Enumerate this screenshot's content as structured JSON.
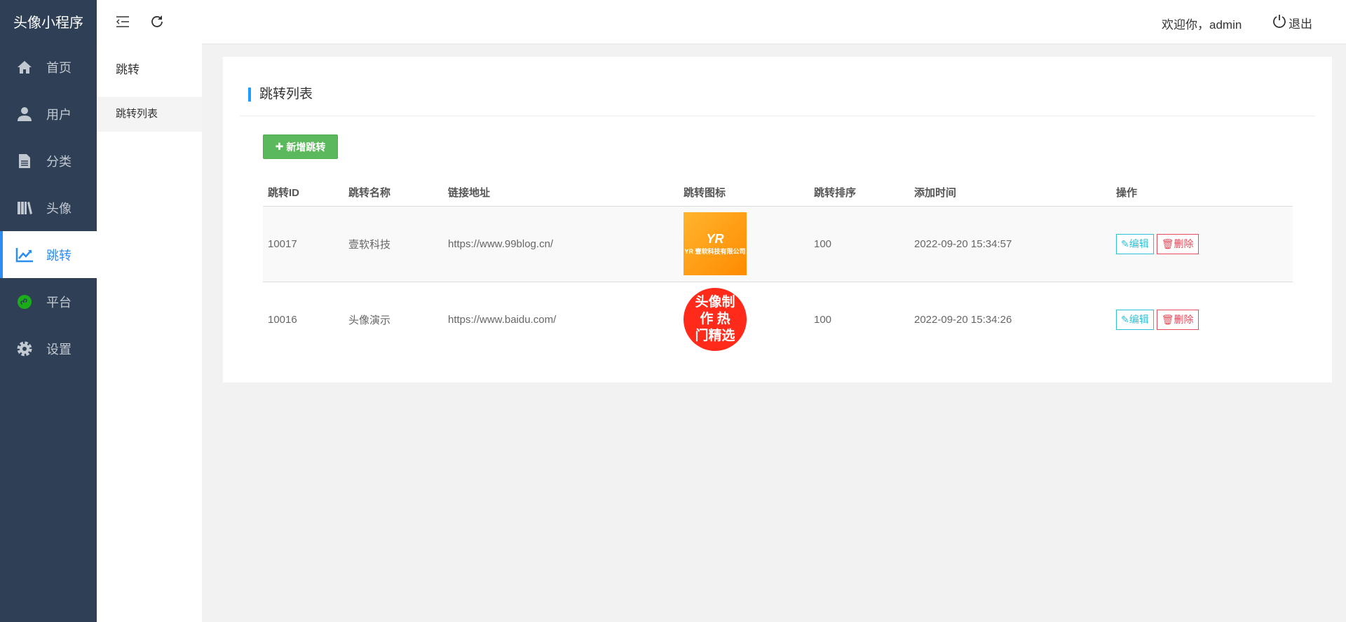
{
  "app": {
    "title": "头像小程序"
  },
  "sidebar": {
    "items": [
      {
        "label": "首页",
        "icon": "home-icon"
      },
      {
        "label": "用户",
        "icon": "user-icon"
      },
      {
        "label": "分类",
        "icon": "file-icon"
      },
      {
        "label": "头像",
        "icon": "books-icon"
      },
      {
        "label": "跳转",
        "icon": "chart-line-icon",
        "active": true
      },
      {
        "label": "平台",
        "icon": "miniprogram-icon"
      },
      {
        "label": "设置",
        "icon": "gear-icon"
      }
    ]
  },
  "header": {
    "welcome": "欢迎你，admin",
    "logout": "退出"
  },
  "subnav": {
    "title": "跳转",
    "items": [
      {
        "label": "跳转列表"
      }
    ]
  },
  "main": {
    "title": "跳转列表",
    "add_button": "新增跳转",
    "columns": [
      "跳转ID",
      "跳转名称",
      "链接地址",
      "跳转图标",
      "跳转排序",
      "添加时间",
      "操作"
    ],
    "rows": [
      {
        "id": "10017",
        "name": "壹软科技",
        "url": "https://www.99blog.cn/",
        "icon_text": "YR 壹软科技有限公司",
        "sort": "100",
        "time": "2022-09-20 15:34:57"
      },
      {
        "id": "10016",
        "name": "头像演示",
        "url": "https://www.baidu.com/",
        "icon_text": "头像制作 热门精选",
        "sort": "100",
        "time": "2022-09-20 15:34:26"
      }
    ],
    "edit_label": "编辑",
    "delete_label": "删除"
  },
  "colors": {
    "sidebar": "#2f4056",
    "accent": "#2d8cf0",
    "add": "#5cb85c",
    "edit": "#2fc0d8",
    "delete": "#e54d5b"
  }
}
